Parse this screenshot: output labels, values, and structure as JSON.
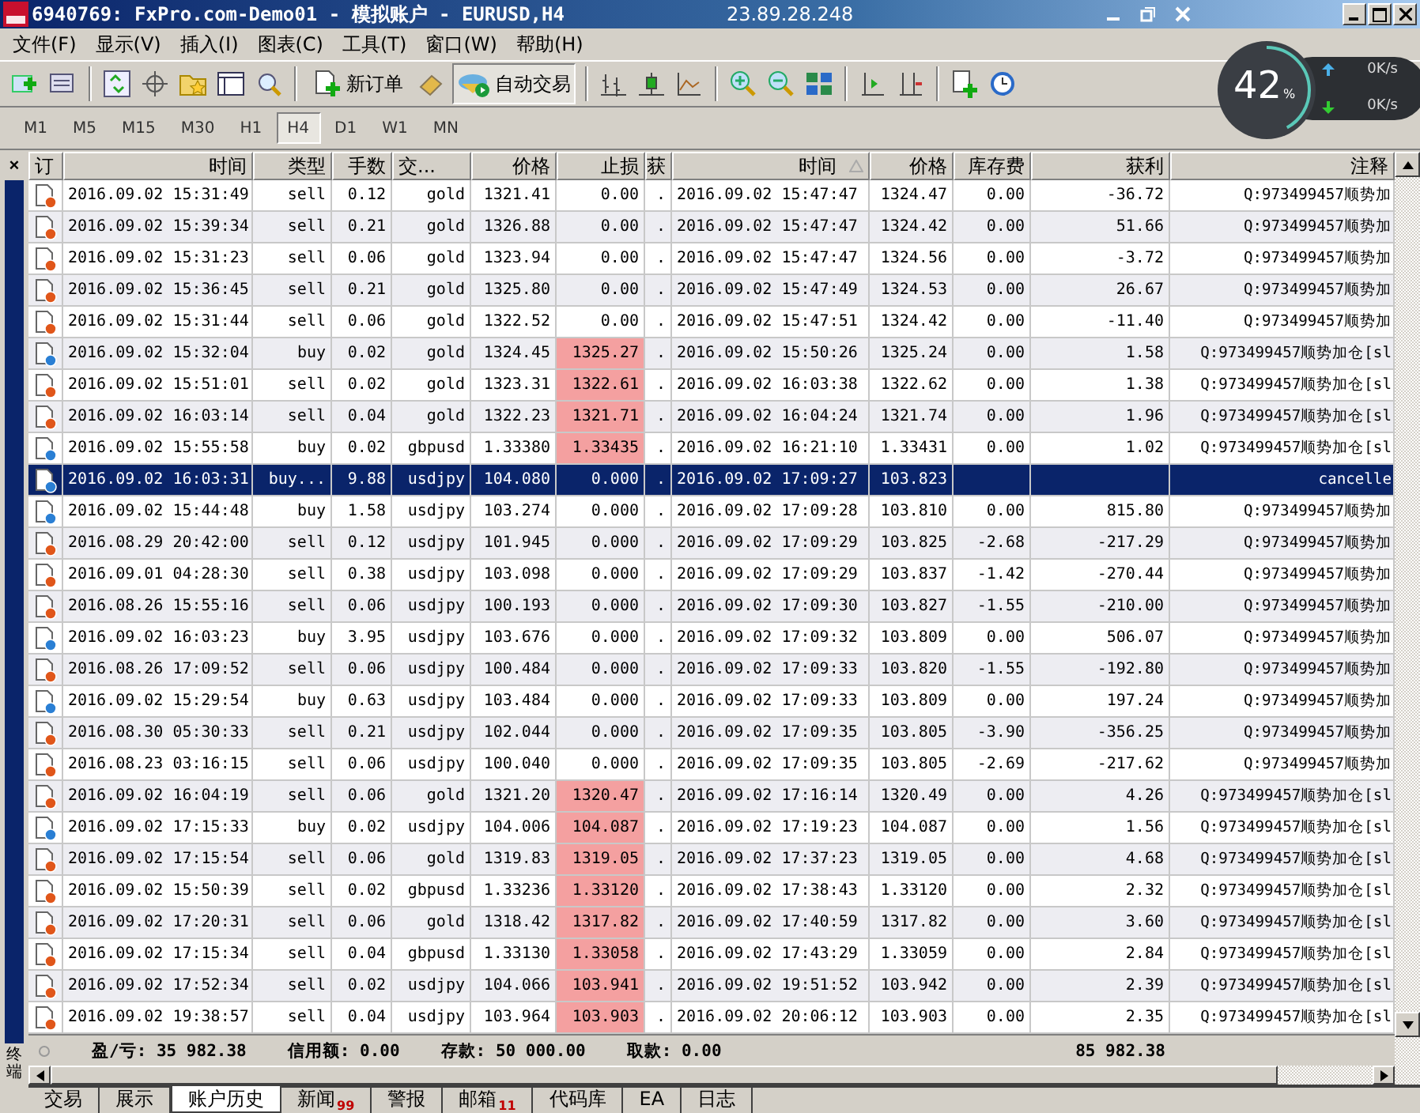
{
  "window": {
    "title": "6940769: FxPro.com-Demo01 - 模拟账户 - EURUSD,H4",
    "remote_host": "23.89.28.248"
  },
  "menu": [
    "文件(F)",
    "显示(V)",
    "插入(I)",
    "图表(C)",
    "工具(T)",
    "窗口(W)",
    "帮助(H)"
  ],
  "toolbar": {
    "new_order": "新订单",
    "auto_trading": "自动交易"
  },
  "net_monitor": {
    "percent": "42",
    "unit": "%",
    "level": 0.42,
    "upload": "0K/s",
    "download": "0K/s"
  },
  "timeframes": [
    {
      "label": "M1",
      "selected": false
    },
    {
      "label": "M5",
      "selected": false
    },
    {
      "label": "M15",
      "selected": false
    },
    {
      "label": "M30",
      "selected": false
    },
    {
      "label": "H1",
      "selected": false
    },
    {
      "label": "H4",
      "selected": true
    },
    {
      "label": "D1",
      "selected": false
    },
    {
      "label": "W1",
      "selected": false
    },
    {
      "label": "MN",
      "selected": false
    }
  ],
  "terminal": {
    "close_glyph": "×",
    "side_label": "终端",
    "columns": [
      "订",
      "时间",
      "类型",
      "手数",
      "交...",
      "价格",
      "止损",
      "获",
      "时间",
      "价格",
      "库存费",
      "获利",
      "注释"
    ],
    "rows": [
      {
        "kind": "sell",
        "selected": false,
        "time": "2016.09.02 15:31:49",
        "type": "sell",
        "lots": "0.12",
        "symbol": "gold",
        "price": "1321.41",
        "stop_loss": "0.00",
        "sl_hit": false,
        "take_profit": ".",
        "close_time": "2016.09.02 15:47:47",
        "close_price": "1324.47",
        "swap": "0.00",
        "profit": "-36.72",
        "comment": "Q:973499457顺势加"
      },
      {
        "kind": "sell",
        "selected": false,
        "time": "2016.09.02 15:39:34",
        "type": "sell",
        "lots": "0.21",
        "symbol": "gold",
        "price": "1326.88",
        "stop_loss": "0.00",
        "sl_hit": false,
        "take_profit": ".",
        "close_time": "2016.09.02 15:47:47",
        "close_price": "1324.42",
        "swap": "0.00",
        "profit": "51.66",
        "comment": "Q:973499457顺势加"
      },
      {
        "kind": "sell",
        "selected": false,
        "time": "2016.09.02 15:31:23",
        "type": "sell",
        "lots": "0.06",
        "symbol": "gold",
        "price": "1323.94",
        "stop_loss": "0.00",
        "sl_hit": false,
        "take_profit": ".",
        "close_time": "2016.09.02 15:47:47",
        "close_price": "1324.56",
        "swap": "0.00",
        "profit": "-3.72",
        "comment": "Q:973499457顺势加"
      },
      {
        "kind": "sell",
        "selected": false,
        "time": "2016.09.02 15:36:45",
        "type": "sell",
        "lots": "0.21",
        "symbol": "gold",
        "price": "1325.80",
        "stop_loss": "0.00",
        "sl_hit": false,
        "take_profit": ".",
        "close_time": "2016.09.02 15:47:49",
        "close_price": "1324.53",
        "swap": "0.00",
        "profit": "26.67",
        "comment": "Q:973499457顺势加"
      },
      {
        "kind": "sell",
        "selected": false,
        "time": "2016.09.02 15:31:44",
        "type": "sell",
        "lots": "0.06",
        "symbol": "gold",
        "price": "1322.52",
        "stop_loss": "0.00",
        "sl_hit": false,
        "take_profit": ".",
        "close_time": "2016.09.02 15:47:51",
        "close_price": "1324.42",
        "swap": "0.00",
        "profit": "-11.40",
        "comment": "Q:973499457顺势加"
      },
      {
        "kind": "buy",
        "selected": false,
        "time": "2016.09.02 15:32:04",
        "type": "buy",
        "lots": "0.02",
        "symbol": "gold",
        "price": "1324.45",
        "stop_loss": "1325.27",
        "sl_hit": true,
        "take_profit": ".",
        "close_time": "2016.09.02 15:50:26",
        "close_price": "1325.24",
        "swap": "0.00",
        "profit": "1.58",
        "comment": "Q:973499457顺势加仓[sl"
      },
      {
        "kind": "sell",
        "selected": false,
        "time": "2016.09.02 15:51:01",
        "type": "sell",
        "lots": "0.02",
        "symbol": "gold",
        "price": "1323.31",
        "stop_loss": "1322.61",
        "sl_hit": true,
        "take_profit": ".",
        "close_time": "2016.09.02 16:03:38",
        "close_price": "1322.62",
        "swap": "0.00",
        "profit": "1.38",
        "comment": "Q:973499457顺势加仓[sl"
      },
      {
        "kind": "sell",
        "selected": false,
        "time": "2016.09.02 16:03:14",
        "type": "sell",
        "lots": "0.04",
        "symbol": "gold",
        "price": "1322.23",
        "stop_loss": "1321.71",
        "sl_hit": true,
        "take_profit": ".",
        "close_time": "2016.09.02 16:04:24",
        "close_price": "1321.74",
        "swap": "0.00",
        "profit": "1.96",
        "comment": "Q:973499457顺势加仓[sl"
      },
      {
        "kind": "buy",
        "selected": false,
        "time": "2016.09.02 15:55:58",
        "type": "buy",
        "lots": "0.02",
        "symbol": "gbpusd",
        "price": "1.33380",
        "stop_loss": "1.33435",
        "sl_hit": true,
        "take_profit": ".",
        "close_time": "2016.09.02 16:21:10",
        "close_price": "1.33431",
        "swap": "0.00",
        "profit": "1.02",
        "comment": "Q:973499457顺势加仓[sl"
      },
      {
        "kind": "buy",
        "selected": true,
        "time": "2016.09.02 16:03:31",
        "type": "buy...",
        "lots": "9.88",
        "symbol": "usdjpy",
        "price": "104.080",
        "stop_loss": "0.000",
        "sl_hit": false,
        "take_profit": ".",
        "close_time": "2016.09.02 17:09:27",
        "close_price": "103.823",
        "comment": "cancelle"
      },
      {
        "kind": "buy",
        "selected": false,
        "time": "2016.09.02 15:44:48",
        "type": "buy",
        "lots": "1.58",
        "symbol": "usdjpy",
        "price": "103.274",
        "stop_loss": "0.000",
        "sl_hit": false,
        "take_profit": ".",
        "close_time": "2016.09.02 17:09:28",
        "close_price": "103.810",
        "swap": "0.00",
        "profit": "815.80",
        "comment": "Q:973499457顺势加"
      },
      {
        "kind": "sell",
        "selected": false,
        "time": "2016.08.29 20:42:00",
        "type": "sell",
        "lots": "0.12",
        "symbol": "usdjpy",
        "price": "101.945",
        "stop_loss": "0.000",
        "sl_hit": false,
        "take_profit": ".",
        "close_time": "2016.09.02 17:09:29",
        "close_price": "103.825",
        "swap": "-2.68",
        "profit": "-217.29",
        "comment": "Q:973499457顺势加"
      },
      {
        "kind": "sell",
        "selected": false,
        "time": "2016.09.01 04:28:30",
        "type": "sell",
        "lots": "0.38",
        "symbol": "usdjpy",
        "price": "103.098",
        "stop_loss": "0.000",
        "sl_hit": false,
        "take_profit": ".",
        "close_time": "2016.09.02 17:09:29",
        "close_price": "103.837",
        "swap": "-1.42",
        "profit": "-270.44",
        "comment": "Q:973499457顺势加"
      },
      {
        "kind": "sell",
        "selected": false,
        "time": "2016.08.26 15:55:16",
        "type": "sell",
        "lots": "0.06",
        "symbol": "usdjpy",
        "price": "100.193",
        "stop_loss": "0.000",
        "sl_hit": false,
        "take_profit": ".",
        "close_time": "2016.09.02 17:09:30",
        "close_price": "103.827",
        "swap": "-1.55",
        "profit": "-210.00",
        "comment": "Q:973499457顺势加"
      },
      {
        "kind": "buy",
        "selected": false,
        "time": "2016.09.02 16:03:23",
        "type": "buy",
        "lots": "3.95",
        "symbol": "usdjpy",
        "price": "103.676",
        "stop_loss": "0.000",
        "sl_hit": false,
        "take_profit": ".",
        "close_time": "2016.09.02 17:09:32",
        "close_price": "103.809",
        "swap": "0.00",
        "profit": "506.07",
        "comment": "Q:973499457顺势加"
      },
      {
        "kind": "sell",
        "selected": false,
        "time": "2016.08.26 17:09:52",
        "type": "sell",
        "lots": "0.06",
        "symbol": "usdjpy",
        "price": "100.484",
        "stop_loss": "0.000",
        "sl_hit": false,
        "take_profit": ".",
        "close_time": "2016.09.02 17:09:33",
        "close_price": "103.820",
        "swap": "-1.55",
        "profit": "-192.80",
        "comment": "Q:973499457顺势加"
      },
      {
        "kind": "buy",
        "selected": false,
        "time": "2016.09.02 15:29:54",
        "type": "buy",
        "lots": "0.63",
        "symbol": "usdjpy",
        "price": "103.484",
        "stop_loss": "0.000",
        "sl_hit": false,
        "take_profit": ".",
        "close_time": "2016.09.02 17:09:33",
        "close_price": "103.809",
        "swap": "0.00",
        "profit": "197.24",
        "comment": "Q:973499457顺势加"
      },
      {
        "kind": "sell",
        "selected": false,
        "time": "2016.08.30 05:30:33",
        "type": "sell",
        "lots": "0.21",
        "symbol": "usdjpy",
        "price": "102.044",
        "stop_loss": "0.000",
        "sl_hit": false,
        "take_profit": ".",
        "close_time": "2016.09.02 17:09:35",
        "close_price": "103.805",
        "swap": "-3.90",
        "profit": "-356.25",
        "comment": "Q:973499457顺势加"
      },
      {
        "kind": "sell",
        "selected": false,
        "time": "2016.08.23 03:16:15",
        "type": "sell",
        "lots": "0.06",
        "symbol": "usdjpy",
        "price": "100.040",
        "stop_loss": "0.000",
        "sl_hit": false,
        "take_profit": ".",
        "close_time": "2016.09.02 17:09:35",
        "close_price": "103.805",
        "swap": "-2.69",
        "profit": "-217.62",
        "comment": "Q:973499457顺势加"
      },
      {
        "kind": "sell",
        "selected": false,
        "time": "2016.09.02 16:04:19",
        "type": "sell",
        "lots": "0.06",
        "symbol": "gold",
        "price": "1321.20",
        "stop_loss": "1320.47",
        "sl_hit": true,
        "take_profit": ".",
        "close_time": "2016.09.02 17:16:14",
        "close_price": "1320.49",
        "swap": "0.00",
        "profit": "4.26",
        "comment": "Q:973499457顺势加仓[sl"
      },
      {
        "kind": "buy",
        "selected": false,
        "time": "2016.09.02 17:15:33",
        "type": "buy",
        "lots": "0.02",
        "symbol": "usdjpy",
        "price": "104.006",
        "stop_loss": "104.087",
        "sl_hit": true,
        "take_profit": ".",
        "close_time": "2016.09.02 17:19:23",
        "close_price": "104.087",
        "swap": "0.00",
        "profit": "1.56",
        "comment": "Q:973499457顺势加仓[sl"
      },
      {
        "kind": "sell",
        "selected": false,
        "time": "2016.09.02 17:15:54",
        "type": "sell",
        "lots": "0.06",
        "symbol": "gold",
        "price": "1319.83",
        "stop_loss": "1319.05",
        "sl_hit": true,
        "take_profit": ".",
        "close_time": "2016.09.02 17:37:23",
        "close_price": "1319.05",
        "swap": "0.00",
        "profit": "4.68",
        "comment": "Q:973499457顺势加仓[sl"
      },
      {
        "kind": "sell",
        "selected": false,
        "time": "2016.09.02 15:50:39",
        "type": "sell",
        "lots": "0.02",
        "symbol": "gbpusd",
        "price": "1.33236",
        "stop_loss": "1.33120",
        "sl_hit": true,
        "take_profit": ".",
        "close_time": "2016.09.02 17:38:43",
        "close_price": "1.33120",
        "swap": "0.00",
        "profit": "2.32",
        "comment": "Q:973499457顺势加仓[sl"
      },
      {
        "kind": "sell",
        "selected": false,
        "time": "2016.09.02 17:20:31",
        "type": "sell",
        "lots": "0.06",
        "symbol": "gold",
        "price": "1318.42",
        "stop_loss": "1317.82",
        "sl_hit": true,
        "take_profit": ".",
        "close_time": "2016.09.02 17:40:59",
        "close_price": "1317.82",
        "swap": "0.00",
        "profit": "3.60",
        "comment": "Q:973499457顺势加仓[sl"
      },
      {
        "kind": "sell",
        "selected": false,
        "time": "2016.09.02 17:15:34",
        "type": "sell",
        "lots": "0.04",
        "symbol": "gbpusd",
        "price": "1.33130",
        "stop_loss": "1.33058",
        "sl_hit": true,
        "take_profit": ".",
        "close_time": "2016.09.02 17:43:29",
        "close_price": "1.33059",
        "swap": "0.00",
        "profit": "2.84",
        "comment": "Q:973499457顺势加仓[sl"
      },
      {
        "kind": "sell",
        "selected": false,
        "time": "2016.09.02 17:52:34",
        "type": "sell",
        "lots": "0.02",
        "symbol": "usdjpy",
        "price": "104.066",
        "stop_loss": "103.941",
        "sl_hit": true,
        "take_profit": ".",
        "close_time": "2016.09.02 19:51:52",
        "close_price": "103.942",
        "swap": "0.00",
        "profit": "2.39",
        "comment": "Q:973499457顺势加仓[sl"
      },
      {
        "kind": "sell",
        "selected": false,
        "time": "2016.09.02 19:38:57",
        "type": "sell",
        "lots": "0.04",
        "symbol": "usdjpy",
        "price": "103.964",
        "stop_loss": "103.903",
        "sl_hit": true,
        "take_profit": ".",
        "close_time": "2016.09.02 20:06:12",
        "close_price": "103.903",
        "swap": "0.00",
        "profit": "2.35",
        "comment": "Q:973499457顺势加仓[sl"
      }
    ],
    "summary": {
      "items": [
        "盈/亏: 35 982.38",
        "信用额: 0.00",
        "存款: 50 000.00",
        "取款: 0.00"
      ],
      "total": "85 982.38"
    },
    "tabs": [
      {
        "label": "交易",
        "selected": false
      },
      {
        "label": "展示",
        "selected": false
      },
      {
        "label": "账户历史",
        "selected": true
      },
      {
        "label": "新闻",
        "badge": "99",
        "selected": false
      },
      {
        "label": "警报",
        "selected": false
      },
      {
        "label": "邮箱",
        "badge": "11",
        "selected": false
      },
      {
        "label": "代码库",
        "selected": false
      },
      {
        "label": "EA",
        "selected": false
      },
      {
        "label": "日志",
        "selected": false
      }
    ]
  }
}
